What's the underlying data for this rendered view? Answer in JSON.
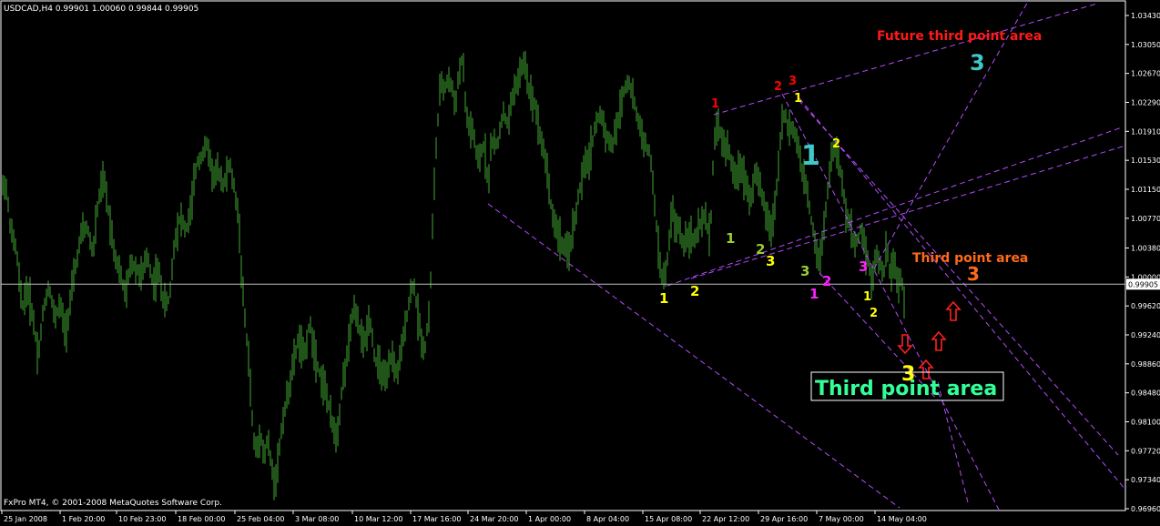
{
  "window": {
    "symbol_header": "USDCAD,H4  0.99901 1.00060 0.99844 0.99905",
    "copyright": "FxPro MT4, © 2001-2008 MetaQuotes Software Corp."
  },
  "colors": {
    "background": "#000000",
    "candles": "#3fa82f",
    "grid_axis": "#ffffff",
    "trendlines": "#b44cff",
    "current_price_line": "#c0c0c0"
  },
  "chart_data": {
    "type": "ohlc-bar",
    "timeframe": "H4",
    "symbol": "USDCAD",
    "current_price": 0.99905,
    "ylim": [
      0.9696,
      1.035
    ],
    "y_ticks": [
      "1.03430",
      "1.03050",
      "1.02670",
      "1.02290",
      "1.01910",
      "1.01530",
      "1.01150",
      "1.00770",
      "1.00380",
      "1.00000",
      "0.99620",
      "0.99240",
      "0.98860",
      "0.98480",
      "0.98100",
      "0.97720",
      "0.97340",
      "0.96960"
    ],
    "x_ticks": [
      "25 Jan 2008",
      "1 Feb 20:00",
      "10 Feb 23:00",
      "18 Feb 00:00",
      "25 Feb 04:00",
      "3 Mar 08:00",
      "10 Mar 12:00",
      "17 Mar 16:00",
      "24 Mar 20:00",
      "1 Apr 00:00",
      "8 Apr 04:00",
      "15 Apr 08:00",
      "22 Apr 12:00",
      "29 Apr 16:00",
      "7 May 00:00",
      "14 May 04:00"
    ],
    "price_path": [
      [
        0,
        1.011
      ],
      [
        6,
        1.0125
      ],
      [
        12,
        1.006
      ],
      [
        18,
        1.0035
      ],
      [
        24,
        0.996
      ],
      [
        30,
        0.9985
      ],
      [
        36,
        0.995
      ],
      [
        42,
        0.9895
      ],
      [
        48,
        0.996
      ],
      [
        54,
        0.999
      ],
      [
        60,
        0.9945
      ],
      [
        66,
        0.9965
      ],
      [
        72,
        0.9925
      ],
      [
        78,
        0.9975
      ],
      [
        84,
        1.002
      ],
      [
        90,
        1.006
      ],
      [
        96,
        1.0065
      ],
      [
        102,
        1.003
      ],
      [
        108,
        1.01
      ],
      [
        114,
        1.013
      ],
      [
        120,
        1.008
      ],
      [
        126,
        1.003
      ],
      [
        132,
        1.0005
      ],
      [
        138,
        0.9975
      ],
      [
        144,
        1.002
      ],
      [
        150,
        1.001
      ],
      [
        156,
        1.0
      ],
      [
        162,
        1.003
      ],
      [
        168,
        0.999
      ],
      [
        174,
        1.001
      ],
      [
        180,
        0.9965
      ],
      [
        186,
        0.997
      ],
      [
        192,
        1.005
      ],
      [
        198,
        1.008
      ],
      [
        204,
        1.006
      ],
      [
        210,
        1.009
      ],
      [
        216,
        1.015
      ],
      [
        222,
        1.016
      ],
      [
        228,
        1.0175
      ],
      [
        234,
        1.013
      ],
      [
        240,
        1.014
      ],
      [
        246,
        1.012
      ],
      [
        252,
        1.015
      ],
      [
        258,
        1.011
      ],
      [
        262,
        1.008
      ],
      [
        266,
        0.999
      ],
      [
        270,
        0.993
      ],
      [
        274,
        0.988
      ],
      [
        278,
        0.979
      ],
      [
        282,
        0.977
      ],
      [
        286,
        0.98
      ],
      [
        290,
        0.976
      ],
      [
        294,
        0.979
      ],
      [
        298,
        0.975
      ],
      [
        302,
        0.973
      ],
      [
        306,
        0.9765
      ],
      [
        310,
        0.981
      ],
      [
        316,
        0.9845
      ],
      [
        322,
        0.9885
      ],
      [
        328,
        0.992
      ],
      [
        334,
        0.9895
      ],
      [
        340,
        0.994
      ],
      [
        346,
        0.99
      ],
      [
        352,
        0.987
      ],
      [
        358,
        0.985
      ],
      [
        364,
        0.981
      ],
      [
        370,
        0.979
      ],
      [
        376,
        0.986
      ],
      [
        382,
        0.99
      ],
      [
        388,
        0.996
      ],
      [
        394,
        0.9935
      ],
      [
        400,
        0.991
      ],
      [
        406,
        0.995
      ],
      [
        412,
        0.989
      ],
      [
        418,
        0.988
      ],
      [
        424,
        0.986
      ],
      [
        430,
        0.99
      ],
      [
        436,
        0.987
      ],
      [
        442,
        0.991
      ],
      [
        448,
        0.996
      ],
      [
        454,
        0.9995
      ],
      [
        460,
        0.994
      ],
      [
        466,
        0.99
      ],
      [
        472,
        0.996
      ],
      [
        476,
        1.01
      ],
      [
        480,
        1.019
      ],
      [
        484,
        1.0255
      ],
      [
        488,
        1.0245
      ],
      [
        492,
        1.026
      ],
      [
        496,
        1.025
      ],
      [
        500,
        1.0225
      ],
      [
        504,
        1.0265
      ],
      [
        508,
        1.029
      ],
      [
        512,
        1.021
      ],
      [
        516,
        1.0195
      ],
      [
        520,
        1.019
      ],
      [
        524,
        1.015
      ],
      [
        528,
        1.016
      ],
      [
        532,
        1.0175
      ],
      [
        536,
        1.012
      ],
      [
        540,
        1.018
      ],
      [
        546,
        1.017
      ],
      [
        552,
        1.0215
      ],
      [
        558,
        1.02
      ],
      [
        564,
        1.0245
      ],
      [
        570,
        1.026
      ],
      [
        576,
        1.0285
      ],
      [
        582,
        1.024
      ],
      [
        588,
        1.0225
      ],
      [
        594,
        1.018
      ],
      [
        600,
        1.015
      ],
      [
        606,
        1.0085
      ],
      [
        612,
        1.006
      ],
      [
        618,
        1.004
      ],
      [
        624,
        1.003
      ],
      [
        630,
        1.0065
      ],
      [
        636,
        1.011
      ],
      [
        642,
        1.0145
      ],
      [
        648,
        1.016
      ],
      [
        654,
        1.02
      ],
      [
        660,
        1.0215
      ],
      [
        666,
        1.0185
      ],
      [
        672,
        1.017
      ],
      [
        678,
        1.02
      ],
      [
        684,
        1.024
      ],
      [
        690,
        1.026
      ],
      [
        696,
        1.023
      ],
      [
        702,
        1.02
      ],
      [
        708,
        1.0175
      ],
      [
        714,
        1.016
      ],
      [
        718,
        1.011
      ],
      [
        722,
        1.005
      ],
      [
        726,
        1.0005
      ],
      [
        730,
        0.9995
      ],
      [
        734,
        1.003
      ],
      [
        738,
        1.0095
      ],
      [
        742,
        1.006
      ],
      [
        746,
        1.007
      ],
      [
        750,
        1.004
      ],
      [
        756,
        1.006
      ],
      [
        762,
        1.0045
      ],
      [
        768,
        1.0065
      ],
      [
        774,
        1.008
      ],
      [
        780,
        1.005
      ],
      [
        784,
        1.0175
      ],
      [
        788,
        1.02
      ],
      [
        792,
        1.0185
      ],
      [
        796,
        1.0165
      ],
      [
        800,
        1.0175
      ],
      [
        804,
        1.014
      ],
      [
        808,
        1.0125
      ],
      [
        812,
        1.015
      ],
      [
        818,
        1.013
      ],
      [
        824,
        1.01
      ],
      [
        830,
        1.014
      ],
      [
        836,
        1.011
      ],
      [
        842,
        1.008
      ],
      [
        848,
        1.006
      ],
      [
        854,
        1.013
      ],
      [
        858,
        1.02
      ],
      [
        862,
        1.0215
      ],
      [
        866,
        1.019
      ],
      [
        870,
        1.02
      ],
      [
        874,
        1.018
      ],
      [
        878,
        1.0165
      ],
      [
        882,
        1.0125
      ],
      [
        886,
        1.012
      ],
      [
        890,
        1.008
      ],
      [
        894,
        1.006
      ],
      [
        898,
        1.002
      ],
      [
        902,
        1.0035
      ],
      [
        906,
        1.008
      ],
      [
        910,
        1.0125
      ],
      [
        914,
        1.0165
      ],
      [
        918,
        1.017
      ],
      [
        922,
        1.0145
      ],
      [
        926,
        1.011
      ],
      [
        930,
        1.008
      ],
      [
        934,
        1.007
      ],
      [
        938,
        1.004
      ],
      [
        942,
        1.005
      ],
      [
        946,
        1.0065
      ],
      [
        950,
        1.004
      ],
      [
        954,
        1.002
      ],
      [
        958,
        0.9985
      ],
      [
        962,
        1.0035
      ],
      [
        966,
        1.002
      ],
      [
        970,
        1.0
      ],
      [
        974,
        1.004
      ],
      [
        978,
        1.0
      ],
      [
        982,
        1.0025
      ],
      [
        986,
        0.9985
      ],
      [
        990,
        1.0
      ],
      [
        994,
        0.996
      ],
      [
        996,
        0.99905
      ]
    ]
  },
  "annotations": {
    "labels": [
      {
        "text": "Future third point area",
        "color": "#ff1a1a"
      },
      {
        "text": "Third point area",
        "color": "#ff6a1a"
      },
      {
        "text": "Third point area",
        "color": "#33ff99"
      },
      {
        "text": "3",
        "color": "#3ec8c8"
      },
      {
        "text": "3",
        "color": "#ff6a1a"
      },
      {
        "text": "3",
        "color": "#ffff00"
      },
      {
        "text": "1",
        "color": "#3ec8c8"
      }
    ],
    "points": [
      {
        "t": "1",
        "c": "#ff0000"
      },
      {
        "t": "2",
        "c": "#ff0000"
      },
      {
        "t": "3",
        "c": "#ff0000"
      },
      {
        "t": "1",
        "c": "#ffff00"
      },
      {
        "t": "2",
        "c": "#ffff00"
      },
      {
        "t": "1",
        "c": "#9acd32"
      },
      {
        "t": "2",
        "c": "#9acd32"
      },
      {
        "t": "3",
        "c": "#ffff00"
      },
      {
        "t": "1",
        "c": "#ffff00"
      },
      {
        "t": "2",
        "c": "#ffff00"
      },
      {
        "t": "3",
        "c": "#9acd32"
      },
      {
        "t": "1",
        "c": "#ff22ff"
      },
      {
        "t": "2",
        "c": "#ff22ff"
      },
      {
        "t": "3",
        "c": "#ff22ff"
      },
      {
        "t": "1",
        "c": "#ffff00"
      },
      {
        "t": "2",
        "c": "#ffff00"
      }
    ],
    "arrows": [
      {
        "dir": "down"
      },
      {
        "dir": "up"
      },
      {
        "dir": "up"
      },
      {
        "dir": "up"
      }
    ]
  }
}
